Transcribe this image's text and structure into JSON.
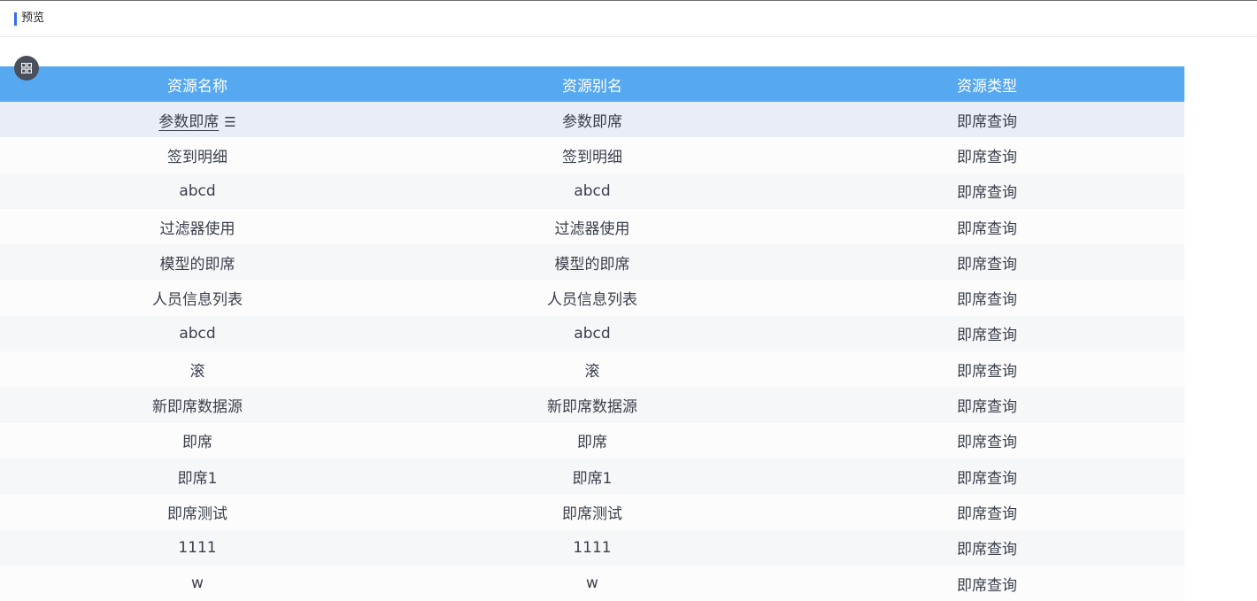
{
  "header": {
    "title": "预览",
    "accent_color": "#2f6fe8"
  },
  "toolbar": {
    "grid_icon": "grid-icon"
  },
  "table": {
    "header_color": "#56a9f1",
    "columns": [
      "资源名称",
      "资源别名",
      "资源类型"
    ],
    "rows": [
      [
        "参数即席",
        "参数即席",
        "即席查询"
      ],
      [
        "签到明细",
        "签到明细",
        "即席查询"
      ],
      [
        "abcd",
        "abcd",
        "即席查询"
      ],
      [
        "过滤器使用",
        "过滤器使用",
        "即席查询"
      ],
      [
        "模型的即席",
        "模型的即席",
        "即席查询"
      ],
      [
        "人员信息列表",
        "人员信息列表",
        "即席查询"
      ],
      [
        "abcd",
        "abcd",
        "即席查询"
      ],
      [
        "滚",
        "滚",
        "即席查询"
      ],
      [
        "新即席数据源",
        "新即席数据源",
        "即席查询"
      ],
      [
        "即席",
        "即席",
        "即席查询"
      ],
      [
        "即席1",
        "即席1",
        "即席查询"
      ],
      [
        "即席测试",
        "即席测试",
        "即席查询"
      ],
      [
        "1111",
        "1111",
        "即席查询"
      ],
      [
        "w",
        "w",
        "即席查询"
      ]
    ],
    "first_row_menu_icon": "menu-icon"
  }
}
